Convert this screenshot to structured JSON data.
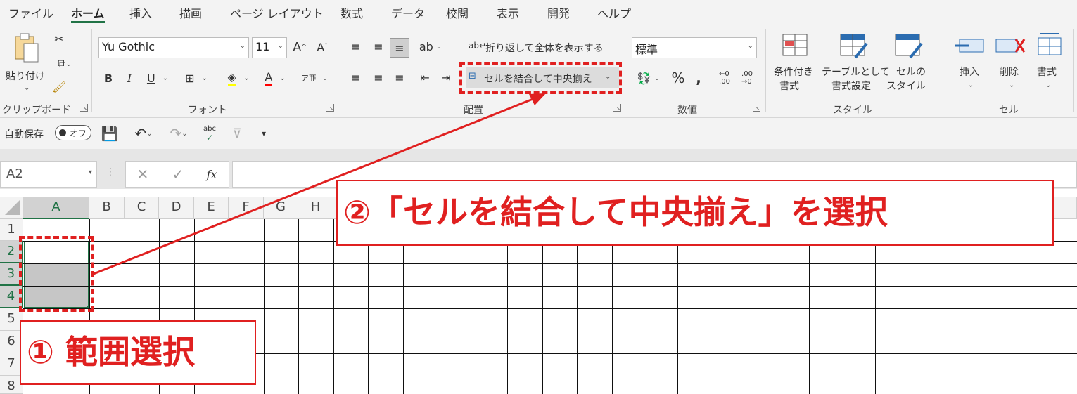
{
  "menu": {
    "tabs": [
      "ファイル",
      "ホーム",
      "挿入",
      "描画",
      "ページ レイアウト",
      "数式",
      "データ",
      "校閲",
      "表示",
      "開発",
      "ヘルプ"
    ]
  },
  "ribbon": {
    "clipboard": {
      "paste_label": "貼り付け",
      "group_label": "クリップボード"
    },
    "font": {
      "font_name": "Yu Gothic",
      "font_size": "11",
      "group_label": "フォント"
    },
    "alignment": {
      "wrap_label": "折り返して全体を表示する",
      "merge_label": "セルを結合して中央揃え",
      "group_label": "配置"
    },
    "number": {
      "format_value": "標準",
      "group_label": "数値"
    },
    "styles": {
      "conditional_label": [
        "条件付き",
        "書式"
      ],
      "table_label": [
        "テーブルとして",
        "書式設定"
      ],
      "cell_style_label": [
        "セルの",
        "スタイル"
      ],
      "group_label": "スタイル"
    },
    "cells": {
      "insert_label": "挿入",
      "delete_label": "削除",
      "format_label": "書式",
      "group_label": "セル"
    }
  },
  "qat": {
    "autosave_label": "自動保存",
    "autosave_state": "オフ"
  },
  "formula_bar": {
    "name_box": "A2",
    "fx": "fx"
  },
  "sheet": {
    "columns": [
      "A",
      "B",
      "C",
      "D",
      "E",
      "F",
      "G",
      "H"
    ],
    "rows": [
      "1",
      "2",
      "3",
      "4",
      "5",
      "6",
      "7",
      "8"
    ]
  },
  "annotations": {
    "step1": "① 範囲選択",
    "step2": "②「セルを結合して中央揃え」を選択"
  },
  "colors": {
    "accent": "#217346",
    "annotation": "#e02020"
  }
}
